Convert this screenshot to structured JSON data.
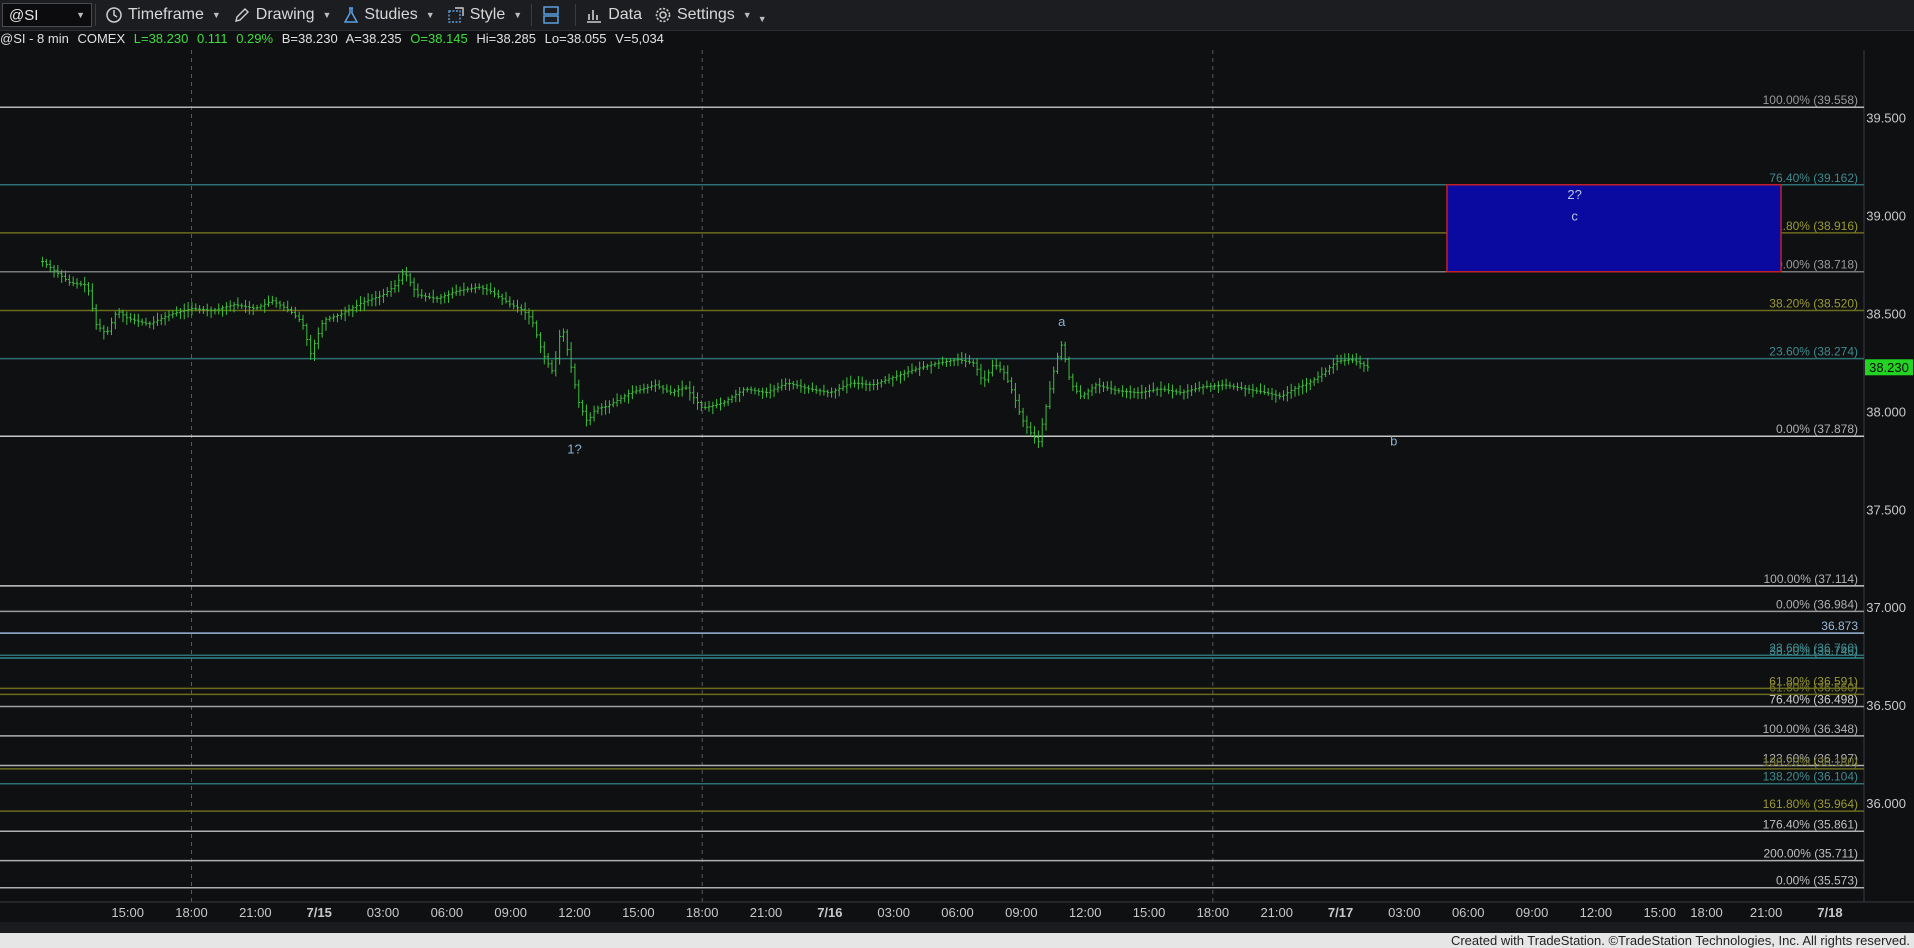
{
  "toolbar": {
    "symbol": "@SI",
    "timeframe": "Timeframe",
    "drawing": "Drawing",
    "studies": "Studies",
    "style": "Style",
    "data": "Data",
    "settings": "Settings"
  },
  "info": {
    "symbol": "@SI - 8 min",
    "exchange": "COMEX",
    "last": "L=38.230",
    "change": "0.111",
    "pct": "0.29%",
    "bid": "B=38.230",
    "ask": "A=38.235",
    "open": "O=38.145",
    "high": "Hi=38.285",
    "low": "Lo=38.055",
    "volume": "V=5,034"
  },
  "footer": "Created with TradeStation. ©TradeStation Technologies, Inc. All rights reserved.",
  "colors": {
    "bars": "#3fbf3f",
    "last_price_bg": "#22d322",
    "box_fill": "#0a0aa0",
    "box_border": "#c0202a"
  },
  "chart_data": {
    "type": "bar",
    "ylim": [
      35.5,
      39.85
    ],
    "yticks": [
      {
        "v": 39.5,
        "label": "39.500"
      },
      {
        "v": 39.0,
        "label": "39.000"
      },
      {
        "v": 38.5,
        "label": "38.500"
      },
      {
        "v": 38.0,
        "label": "38.000"
      },
      {
        "v": 37.5,
        "label": "37.500"
      },
      {
        "v": 37.0,
        "label": "37.000"
      },
      {
        "v": 36.5,
        "label": "36.500"
      },
      {
        "v": 36.0,
        "label": "36.000"
      }
    ],
    "last_price": {
      "v": 38.23,
      "label": "38.230"
    },
    "xticks": [
      {
        "t": 6.0,
        "label": "15:00"
      },
      {
        "t": 9.0,
        "label": "18:00"
      },
      {
        "t": 12.0,
        "label": "21:00"
      },
      {
        "t": 15.0,
        "label": "7/15"
      },
      {
        "t": 18.0,
        "label": "03:00"
      },
      {
        "t": 21.0,
        "label": "06:00"
      },
      {
        "t": 24.0,
        "label": "09:00"
      },
      {
        "t": 27.0,
        "label": "12:00"
      },
      {
        "t": 30.0,
        "label": "15:00"
      },
      {
        "t": 33.0,
        "label": "18:00"
      },
      {
        "t": 36.0,
        "label": "21:00"
      },
      {
        "t": 39.0,
        "label": "7/16"
      },
      {
        "t": 42.0,
        "label": "03:00"
      },
      {
        "t": 45.0,
        "label": "06:00"
      },
      {
        "t": 48.0,
        "label": "09:00"
      },
      {
        "t": 51.0,
        "label": "12:00"
      },
      {
        "t": 54.0,
        "label": "15:00"
      },
      {
        "t": 57.0,
        "label": "18:00"
      },
      {
        "t": 60.0,
        "label": "21:00"
      },
      {
        "t": 63.0,
        "label": "7/17"
      },
      {
        "t": 66.0,
        "label": "03:00"
      },
      {
        "t": 69.0,
        "label": "06:00"
      },
      {
        "t": 72.0,
        "label": "09:00"
      },
      {
        "t": 75.0,
        "label": "12:00"
      },
      {
        "t": 78.0,
        "label": "15:00"
      },
      {
        "t": 80.2,
        "label": "18:00"
      },
      {
        "t": 83.0,
        "label": "21:00"
      },
      {
        "t": 86.0,
        "label": "7/18"
      }
    ],
    "price_path": [
      [
        2.0,
        38.77
      ],
      [
        2.6,
        38.72
      ],
      [
        3.3,
        38.66
      ],
      [
        4.1,
        38.65
      ],
      [
        4.5,
        38.45
      ],
      [
        5.0,
        38.4
      ],
      [
        5.5,
        38.52
      ],
      [
        6.0,
        38.48
      ],
      [
        7.0,
        38.45
      ],
      [
        8.0,
        38.5
      ],
      [
        9.0,
        38.53
      ],
      [
        10.0,
        38.52
      ],
      [
        11.0,
        38.55
      ],
      [
        12.0,
        38.53
      ],
      [
        12.8,
        38.57
      ],
      [
        13.6,
        38.52
      ],
      [
        14.2,
        38.46
      ],
      [
        14.6,
        38.3
      ],
      [
        15.2,
        38.47
      ],
      [
        16.0,
        38.5
      ],
      [
        17.0,
        38.56
      ],
      [
        18.0,
        38.6
      ],
      [
        18.6,
        38.65
      ],
      [
        19.0,
        38.72
      ],
      [
        19.6,
        38.6
      ],
      [
        20.5,
        38.58
      ],
      [
        21.5,
        38.62
      ],
      [
        22.5,
        38.64
      ],
      [
        23.0,
        38.62
      ],
      [
        23.6,
        38.58
      ],
      [
        24.0,
        38.55
      ],
      [
        24.6,
        38.52
      ],
      [
        25.0,
        38.47
      ],
      [
        25.5,
        38.3
      ],
      [
        26.0,
        38.2
      ],
      [
        26.4,
        38.45
      ],
      [
        26.8,
        38.25
      ],
      [
        27.2,
        38.05
      ],
      [
        27.6,
        37.95
      ],
      [
        28.0,
        38.02
      ],
      [
        28.5,
        38.03
      ],
      [
        29.0,
        38.06
      ],
      [
        29.6,
        38.1
      ],
      [
        30.2,
        38.12
      ],
      [
        30.8,
        38.14
      ],
      [
        31.5,
        38.1
      ],
      [
        32.2,
        38.13
      ],
      [
        33.0,
        38.02
      ],
      [
        34.0,
        38.05
      ],
      [
        35.0,
        38.12
      ],
      [
        36.0,
        38.1
      ],
      [
        37.0,
        38.15
      ],
      [
        38.0,
        38.12
      ],
      [
        39.0,
        38.1
      ],
      [
        40.0,
        38.15
      ],
      [
        41.0,
        38.14
      ],
      [
        42.0,
        38.18
      ],
      [
        43.0,
        38.22
      ],
      [
        44.0,
        38.25
      ],
      [
        45.0,
        38.27
      ],
      [
        45.8,
        38.25
      ],
      [
        46.2,
        38.15
      ],
      [
        46.7,
        38.25
      ],
      [
        47.2,
        38.2
      ],
      [
        47.6,
        38.1
      ],
      [
        48.0,
        37.97
      ],
      [
        48.4,
        37.9
      ],
      [
        48.8,
        37.85
      ],
      [
        49.2,
        38.05
      ],
      [
        49.6,
        38.25
      ],
      [
        49.9,
        38.35
      ],
      [
        50.3,
        38.15
      ],
      [
        50.8,
        38.08
      ],
      [
        51.5,
        38.14
      ],
      [
        52.5,
        38.11
      ],
      [
        53.5,
        38.1
      ],
      [
        54.5,
        38.12
      ],
      [
        55.5,
        38.1
      ],
      [
        56.5,
        38.13
      ],
      [
        57.5,
        38.14
      ],
      [
        58.5,
        38.12
      ],
      [
        59.5,
        38.1
      ],
      [
        60.2,
        38.08
      ],
      [
        60.8,
        38.12
      ],
      [
        61.5,
        38.15
      ],
      [
        62.2,
        38.2
      ],
      [
        62.8,
        38.26
      ],
      [
        63.5,
        38.27
      ],
      [
        64.3,
        38.23
      ]
    ],
    "annotations": [
      {
        "text": "1?",
        "t": 27.0,
        "v": 37.79,
        "color": "#8ab0d0"
      },
      {
        "text": "a",
        "t": 49.9,
        "v": 38.44,
        "color": "#8ab0d0"
      },
      {
        "text": "b",
        "t": 65.5,
        "v": 37.83,
        "color": "#8ab0d0"
      },
      {
        "text": "2?",
        "t": 74.0,
        "v": 39.09,
        "color": "#b0c8e8"
      },
      {
        "text": "c",
        "t": 74.0,
        "v": 38.98,
        "color": "#b0c8e8"
      }
    ],
    "target_box": {
      "t0": 68.0,
      "t1": 83.7,
      "v0": 38.718,
      "v1": 39.162
    },
    "fib_levels": [
      {
        "v": 39.558,
        "label": "100.00% (39.558)",
        "color": "#b8b8b8",
        "tc": "#9a9a9a"
      },
      {
        "v": 39.162,
        "label": "76.40% (39.162)",
        "color": "#2e6f72",
        "tc": "#3f8a8e"
      },
      {
        "v": 38.916,
        "label": "61.80% (38.916)",
        "color": "#6b6b1e",
        "tc": "#9a9a30"
      },
      {
        "v": 38.718,
        "label": "50.00% (38.718)",
        "color": "#7a7a7a",
        "tc": "#9a9a9a"
      },
      {
        "v": 38.52,
        "label": "38.20% (38.520)",
        "color": "#6b6b1e",
        "tc": "#9a9a30"
      },
      {
        "v": 38.274,
        "label": "23.60% (38.274)",
        "color": "#2e6f72",
        "tc": "#3f8a8e"
      },
      {
        "v": 37.878,
        "label": "0.00% (37.878)",
        "color": "#c8c8c8",
        "tc": "#b0b0b0"
      },
      {
        "v": 37.114,
        "label": "100.00% (37.114)",
        "color": "#c8c8c8",
        "tc": "#b0b0b0"
      },
      {
        "v": 36.984,
        "label": "0.00% (36.984)",
        "color": "#9a9a9a",
        "tc": "#b0b0b0"
      },
      {
        "v": 36.873,
        "label": "36.873",
        "color": "#9ab8d8",
        "tc": "#9ab8d8"
      },
      {
        "v": 36.76,
        "label": "23.60% (36.760)",
        "color": "#2e6f72",
        "tc": "#3f8a8e"
      },
      {
        "v": 36.746,
        "label": "38.20% (36.746)",
        "color": "#2e8a8e",
        "tc": "#3f8a8e"
      },
      {
        "v": 36.591,
        "label": "61.80% (36.591)",
        "color": "#6b6b1e",
        "tc": "#9a9a30"
      },
      {
        "v": 36.56,
        "label": "61.80% (36.560)",
        "color": "#6b6b1e",
        "tc": "#7a7a28"
      },
      {
        "v": 36.498,
        "label": "76.40% (36.498)",
        "color": "#a0a0a0",
        "tc": "#d0d0d0"
      },
      {
        "v": 36.348,
        "label": "100.00% (36.348)",
        "color": "#b0b0b0",
        "tc": "#b0b0b0"
      },
      {
        "v": 36.197,
        "label": "123.60% (36.197)",
        "color": "#b0b0b0",
        "tc": "#b0b0b0"
      },
      {
        "v": 36.18,
        "label": "138.20% (36.180)",
        "color": "#6b6b1e",
        "tc": "#7a7a28"
      },
      {
        "v": 36.104,
        "label": "138.20% (36.104)",
        "color": "#2e6f72",
        "tc": "#3f8a8e"
      },
      {
        "v": 35.964,
        "label": "161.80% (35.964)",
        "color": "#6b6b1e",
        "tc": "#9a9a30"
      },
      {
        "v": 35.861,
        "label": "176.40% (35.861)",
        "color": "#b0b0b0",
        "tc": "#c0c0c0"
      },
      {
        "v": 35.711,
        "label": "200.00% (35.711)",
        "color": "#b0b0b0",
        "tc": "#c0c0c0"
      },
      {
        "v": 35.573,
        "label": "0.00% (35.573)",
        "color": "#b0b0b0",
        "tc": "#c0c0c0"
      }
    ]
  }
}
